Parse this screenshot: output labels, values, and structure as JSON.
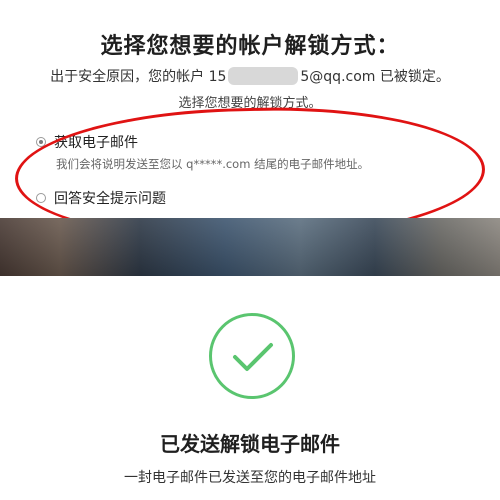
{
  "unlock": {
    "title": "选择您想要的帐户解锁方式：",
    "reason_prefix": "出于安全原因，您的帐户 15",
    "reason_suffix": "5@qq.com 已被锁定。",
    "instruction": "选择您想要的解锁方式。",
    "options": [
      {
        "label": "获取电子邮件",
        "description": "我们会将说明发送至您以 q*****.com 结尾的电子邮件地址。",
        "selected": true
      },
      {
        "label": "回答安全提示问题",
        "selected": false
      }
    ]
  },
  "confirmation": {
    "title": "已发送解锁电子邮件",
    "subtitle": "一封电子邮件已发送至您的电子邮件地址"
  },
  "colors": {
    "annotation_red": "#e01313",
    "success_green": "#5ac56f"
  },
  "icons": {
    "success": "checkmark-icon"
  }
}
